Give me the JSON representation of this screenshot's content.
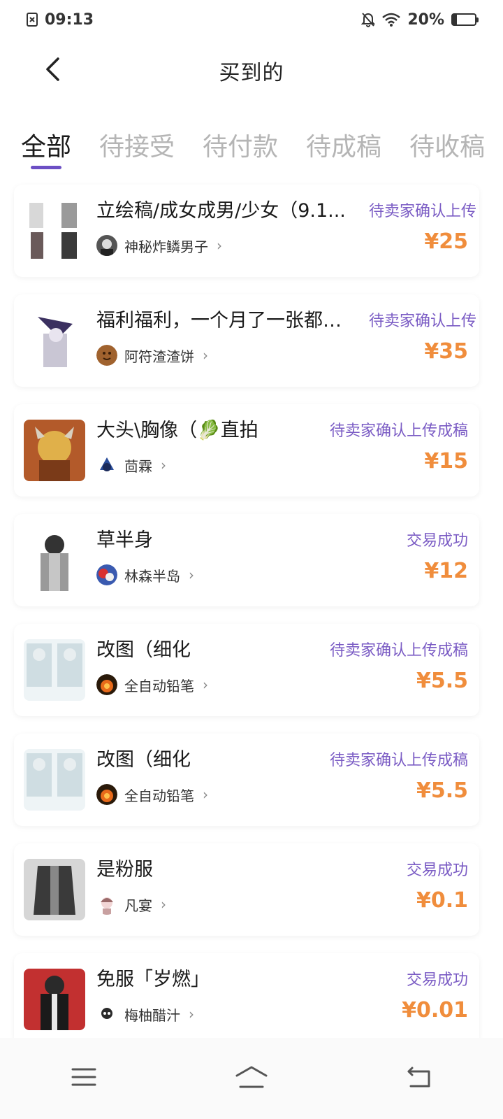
{
  "status_bar": {
    "time": "09:13",
    "battery_text": "20%",
    "battery_level": 0.2
  },
  "header": {
    "title": "买到的",
    "back_icon": "chevron-left-icon"
  },
  "tabs": [
    {
      "label": "全部",
      "active": true
    },
    {
      "label": "待接受",
      "active": false
    },
    {
      "label": "待付款",
      "active": false
    },
    {
      "label": "待成稿",
      "active": false
    },
    {
      "label": "待收稿",
      "active": false
    }
  ],
  "orders": [
    {
      "title": "立绘稿/成女成男/少女（9.1...",
      "seller": "神秘炸鳞男子",
      "status": "待卖家确认上传",
      "price": "¥25"
    },
    {
      "title": "福利福利，一个月了一张都没…",
      "seller": "阿符渣渣饼",
      "status": "待卖家确认上传",
      "price": "¥35"
    },
    {
      "title": "大头\\胸像（🥬直拍",
      "seller": "茴霖",
      "status": "待卖家确认上传成稿",
      "price": "¥15"
    },
    {
      "title": "草半身",
      "seller": "林森半岛",
      "status": "交易成功",
      "price": "¥12"
    },
    {
      "title": "改图（细化",
      "seller": "全自动铅笔",
      "status": "待卖家确认上传成稿",
      "price": "¥5.5"
    },
    {
      "title": "改图（细化",
      "seller": "全自动铅笔",
      "status": "待卖家确认上传成稿",
      "price": "¥5.5"
    },
    {
      "title": "是粉服",
      "seller": "凡宴",
      "status": "交易成功",
      "price": "¥0.1"
    },
    {
      "title": "免服「岁燃」",
      "seller": "梅柚醋汁",
      "status": "交易成功",
      "price": "¥0.01"
    }
  ],
  "bottom_nav": {
    "menu_icon": "menu-icon",
    "home_icon": "home-icon",
    "back_icon": "back-icon"
  },
  "colors": {
    "accent": "#6c4fc4",
    "status_text": "#7a5bc4",
    "price": "#f08d3c",
    "tab_inactive": "#b5b5b5"
  }
}
